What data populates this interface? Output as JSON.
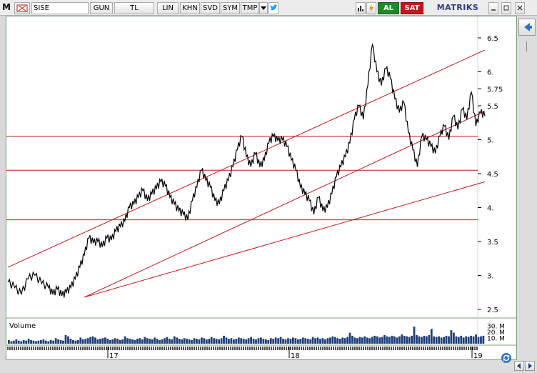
{
  "toolbar": {
    "logo": "M",
    "symbol": "SISE",
    "period": "GUN",
    "currency": "TL",
    "scale": "LIN",
    "khn": "KHN",
    "svd": "SVD",
    "sym": "SYM",
    "tmp": "TMP",
    "buy": "AL",
    "sell": "SAT",
    "brand": "MATRIKS"
  },
  "colors": {
    "accent_buy": "#1e8a2a",
    "accent_sell": "#c4161c",
    "trendline": "#c4161c",
    "volume": "#1f3f7a",
    "price": "#000000",
    "frame": "#7aa07a"
  },
  "chart_data": {
    "type": "line",
    "symbol": "SISE",
    "y_axis_ticks": [
      "6.5",
      "6.",
      "5.75",
      "5.5",
      "5.",
      "4.5",
      "4.",
      "3.5",
      "3.",
      "2.5"
    ],
    "y_tick_values": [
      6.5,
      6.0,
      5.75,
      5.5,
      5.0,
      4.5,
      4.0,
      3.5,
      3.0,
      2.5
    ],
    "ylim": [
      2.5,
      6.5
    ],
    "x_axis_ticks": [
      "17",
      "18",
      "19"
    ],
    "horizontal_levels": [
      5.05,
      4.55,
      3.82
    ],
    "price_series": [
      [
        0,
        2.9
      ],
      [
        3,
        2.82
      ],
      [
        6,
        2.72
      ],
      [
        9,
        2.95
      ],
      [
        12,
        3.0
      ],
      [
        15,
        2.88
      ],
      [
        18,
        2.82
      ],
      [
        20,
        2.72
      ],
      [
        22,
        2.8
      ],
      [
        24,
        2.7
      ],
      [
        26,
        2.75
      ],
      [
        28,
        2.82
      ],
      [
        30,
        2.95
      ],
      [
        32,
        3.12
      ],
      [
        34,
        3.3
      ],
      [
        36,
        3.55
      ],
      [
        38,
        3.48
      ],
      [
        40,
        3.5
      ],
      [
        42,
        3.42
      ],
      [
        44,
        3.55
      ],
      [
        46,
        3.52
      ],
      [
        48,
        3.65
      ],
      [
        50,
        3.72
      ],
      [
        52,
        3.8
      ],
      [
        54,
        4.0
      ],
      [
        56,
        4.05
      ],
      [
        58,
        4.15
      ],
      [
        60,
        4.25
      ],
      [
        62,
        4.1
      ],
      [
        64,
        4.2
      ],
      [
        66,
        4.28
      ],
      [
        68,
        4.38
      ],
      [
        70,
        4.32
      ],
      [
        72,
        4.15
      ],
      [
        74,
        4.05
      ],
      [
        76,
        3.95
      ],
      [
        78,
        3.9
      ],
      [
        80,
        3.82
      ],
      [
        82,
        4.1
      ],
      [
        84,
        4.3
      ],
      [
        86,
        4.55
      ],
      [
        88,
        4.4
      ],
      [
        90,
        4.3
      ],
      [
        92,
        4.1
      ],
      [
        94,
        4.05
      ],
      [
        96,
        4.25
      ],
      [
        98,
        4.4
      ],
      [
        100,
        4.6
      ],
      [
        102,
        4.85
      ],
      [
        104,
        5.05
      ],
      [
        106,
        4.75
      ],
      [
        108,
        4.6
      ],
      [
        110,
        4.8
      ],
      [
        112,
        4.6
      ],
      [
        114,
        4.7
      ],
      [
        116,
        4.95
      ],
      [
        118,
        5.05
      ],
      [
        120,
        4.98
      ],
      [
        122,
        5.0
      ],
      [
        124,
        4.9
      ],
      [
        126,
        4.7
      ],
      [
        128,
        4.55
      ],
      [
        130,
        4.3
      ],
      [
        132,
        4.2
      ],
      [
        134,
        4.1
      ],
      [
        136,
        3.9
      ],
      [
        138,
        4.15
      ],
      [
        140,
        3.95
      ],
      [
        142,
        4.0
      ],
      [
        144,
        4.2
      ],
      [
        146,
        4.45
      ],
      [
        148,
        4.6
      ],
      [
        150,
        4.75
      ],
      [
        152,
        4.95
      ],
      [
        154,
        5.3
      ],
      [
        156,
        5.5
      ],
      [
        158,
        5.3
      ],
      [
        160,
        5.8
      ],
      [
        162,
        6.4
      ],
      [
        164,
        6.0
      ],
      [
        166,
        5.8
      ],
      [
        168,
        6.05
      ],
      [
        170,
        5.9
      ],
      [
        172,
        5.6
      ],
      [
        174,
        5.4
      ],
      [
        176,
        5.55
      ],
      [
        178,
        5.1
      ],
      [
        180,
        4.85
      ],
      [
        182,
        4.6
      ],
      [
        184,
        5.05
      ],
      [
        186,
        5.0
      ],
      [
        188,
        4.9
      ],
      [
        190,
        4.8
      ],
      [
        192,
        5.05
      ],
      [
        194,
        5.2
      ],
      [
        196,
        5.0
      ],
      [
        198,
        5.35
      ],
      [
        200,
        5.15
      ],
      [
        202,
        5.45
      ],
      [
        204,
        5.3
      ],
      [
        206,
        5.7
      ],
      [
        208,
        5.2
      ],
      [
        210,
        5.4
      ],
      [
        212,
        5.35
      ]
    ],
    "trendlines": [
      {
        "from": [
          0,
          3.12
        ],
        "to": [
          212,
          6.32
        ]
      },
      {
        "from": [
          34,
          2.68
        ],
        "to": [
          212,
          5.42
        ]
      },
      {
        "from": [
          34,
          2.68
        ],
        "to": [
          212,
          4.38
        ]
      }
    ],
    "volume": {
      "label": "Volume",
      "axis_ticks": [
        "30. M",
        "20. M",
        "10. M"
      ],
      "ylim": [
        0,
        35
      ],
      "values": [
        6,
        4,
        5,
        7,
        5,
        4,
        6,
        5,
        8,
        6,
        5,
        4,
        5,
        6,
        7,
        5,
        4,
        6,
        5,
        9,
        7,
        6,
        5,
        14,
        12,
        8,
        6,
        5,
        6,
        10,
        7,
        8,
        9,
        11,
        12,
        10,
        7,
        8,
        9,
        10,
        8,
        6,
        7,
        9,
        8,
        6,
        7,
        12,
        9,
        8,
        7,
        6,
        8,
        9,
        7,
        11,
        9,
        8,
        7,
        10,
        8,
        6,
        7,
        9,
        11,
        8,
        7,
        12,
        10,
        8,
        7,
        9,
        8,
        7,
        6,
        9,
        8,
        7,
        10,
        9,
        7,
        8,
        11,
        9,
        8,
        7,
        9,
        13,
        10,
        8,
        9,
        7,
        8,
        10,
        9,
        8,
        7,
        9,
        11,
        8,
        7,
        9,
        10,
        8,
        7,
        6,
        9,
        8,
        10,
        9,
        11,
        8,
        7,
        9,
        8,
        10,
        9,
        7,
        8,
        10,
        9,
        8,
        7,
        11,
        9,
        10,
        8,
        9,
        7,
        9,
        10,
        12,
        11,
        9,
        8,
        10,
        9,
        11,
        18,
        13,
        10,
        9,
        11,
        10,
        12,
        10,
        9,
        11,
        13,
        12,
        10,
        11,
        14,
        12,
        11,
        13,
        12,
        10,
        12,
        15,
        13,
        12,
        11,
        13,
        28,
        14,
        12,
        11,
        13,
        12,
        14,
        24,
        12,
        11,
        12,
        10,
        11,
        13,
        12,
        22,
        18,
        12,
        11,
        13,
        10,
        12,
        11,
        13,
        12,
        15,
        11,
        12,
        13
      ]
    }
  }
}
